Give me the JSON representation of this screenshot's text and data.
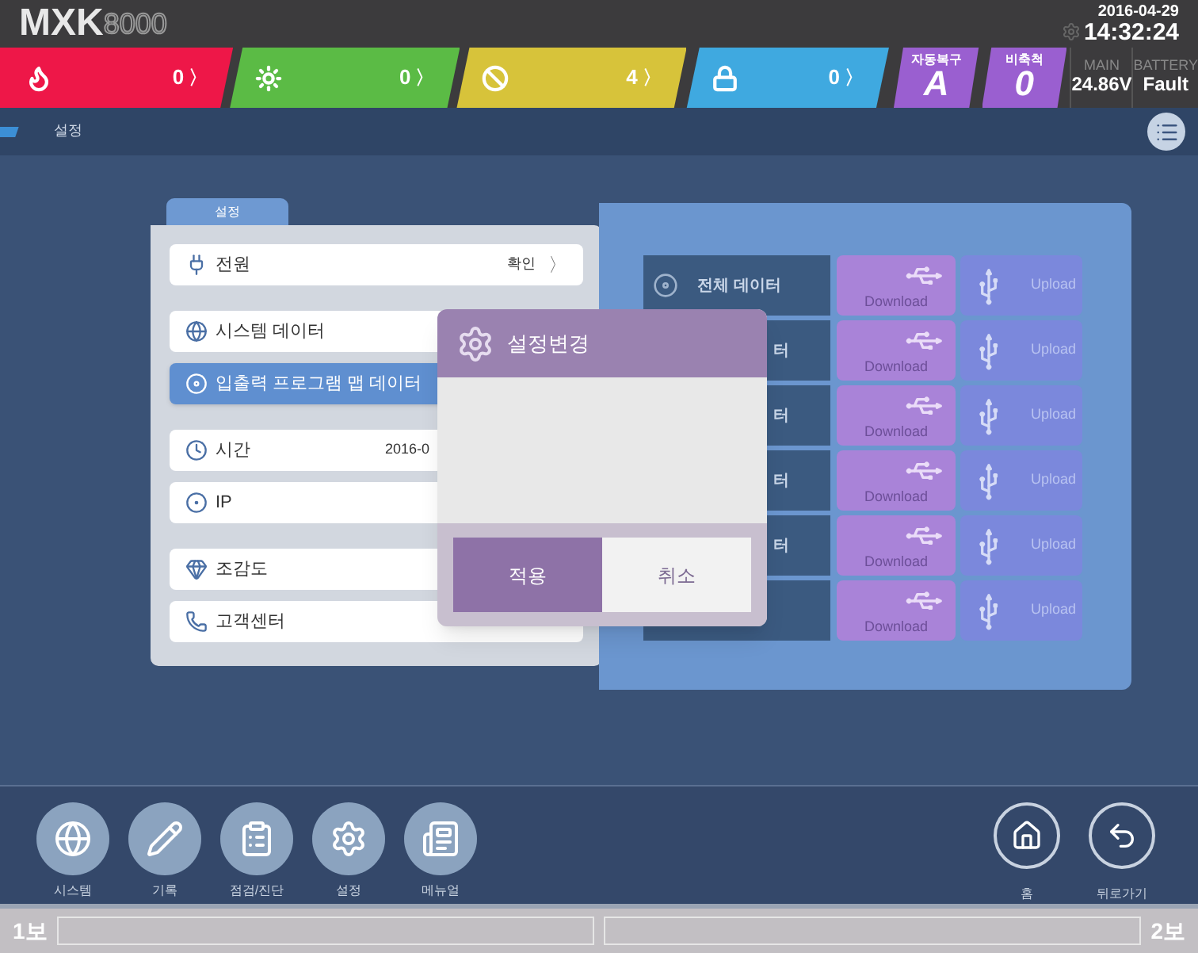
{
  "header": {
    "logo": "MXK",
    "logo_model": "8000",
    "date": "2016-04-29",
    "time": "14:32:24"
  },
  "status_bar": {
    "counters": [
      {
        "kind": "fire",
        "count": "0",
        "chevron": "〉",
        "color": "#ee1748"
      },
      {
        "kind": "fault",
        "count": "0",
        "chevron": "〉",
        "color": "#5bbb45"
      },
      {
        "kind": "disabled",
        "count": "4",
        "chevron": "〉",
        "color": "#d7c33a"
      },
      {
        "kind": "lock",
        "count": "0",
        "chevron": "〉",
        "color": "#3fa9e0"
      }
    ],
    "modes": [
      {
        "label": "자동복구",
        "value": "A"
      },
      {
        "label": "비축척",
        "value": "0"
      }
    ],
    "power": [
      {
        "label": "MAIN",
        "value": "24.86V"
      },
      {
        "label": "BATTERY",
        "value": "Fault"
      }
    ]
  },
  "breadcrumb": "설정",
  "settings_tab": "설정",
  "settings_groups": [
    [
      {
        "kind": "power",
        "label": "전원",
        "value": "확인",
        "chevron": "〉",
        "selected": false
      }
    ],
    [
      {
        "kind": "system",
        "label": "시스템 데이터",
        "selected": false
      },
      {
        "kind": "map",
        "label": "입출력 프로그램 맵 데이터",
        "selected": true
      }
    ],
    [
      {
        "kind": "time",
        "label": "시간",
        "value": "2016-0",
        "selected": false
      },
      {
        "kind": "ip",
        "label": "IP",
        "selected": false
      }
    ],
    [
      {
        "kind": "view",
        "label": "조감도",
        "selected": false
      },
      {
        "kind": "support",
        "label": "고객센터",
        "selected": false
      }
    ]
  ],
  "data_rows": [
    {
      "kind": "all",
      "label": "전체 데이터",
      "download": "Download",
      "upload": "Upload"
    },
    {
      "kind": "item",
      "label": "터",
      "download": "Download",
      "upload": "Upload"
    },
    {
      "kind": "item",
      "label": "터",
      "download": "Download",
      "upload": "Upload"
    },
    {
      "kind": "item",
      "label": "터",
      "download": "Download",
      "upload": "Upload"
    },
    {
      "kind": "item",
      "label": "터",
      "download": "Download",
      "upload": "Upload"
    },
    {
      "kind": "item",
      "download": "Download",
      "upload": "Upload"
    }
  ],
  "dialog": {
    "title": "설정변경",
    "buttons": [
      {
        "label": "적용",
        "kind": "primary"
      },
      {
        "label": "취소",
        "kind": "secondary"
      }
    ]
  },
  "nav": [
    {
      "kind": "system",
      "label": "시스템"
    },
    {
      "kind": "log",
      "label": "기록"
    },
    {
      "kind": "check",
      "label": "점검/진단"
    },
    {
      "kind": "settings",
      "label": "설정"
    },
    {
      "kind": "manual",
      "label": "메뉴얼"
    }
  ],
  "nav_right": [
    {
      "kind": "home",
      "label": "홈"
    },
    {
      "kind": "back",
      "label": "뒤로가기"
    }
  ],
  "bottom_bar": {
    "left": "1보",
    "right": "2보"
  }
}
